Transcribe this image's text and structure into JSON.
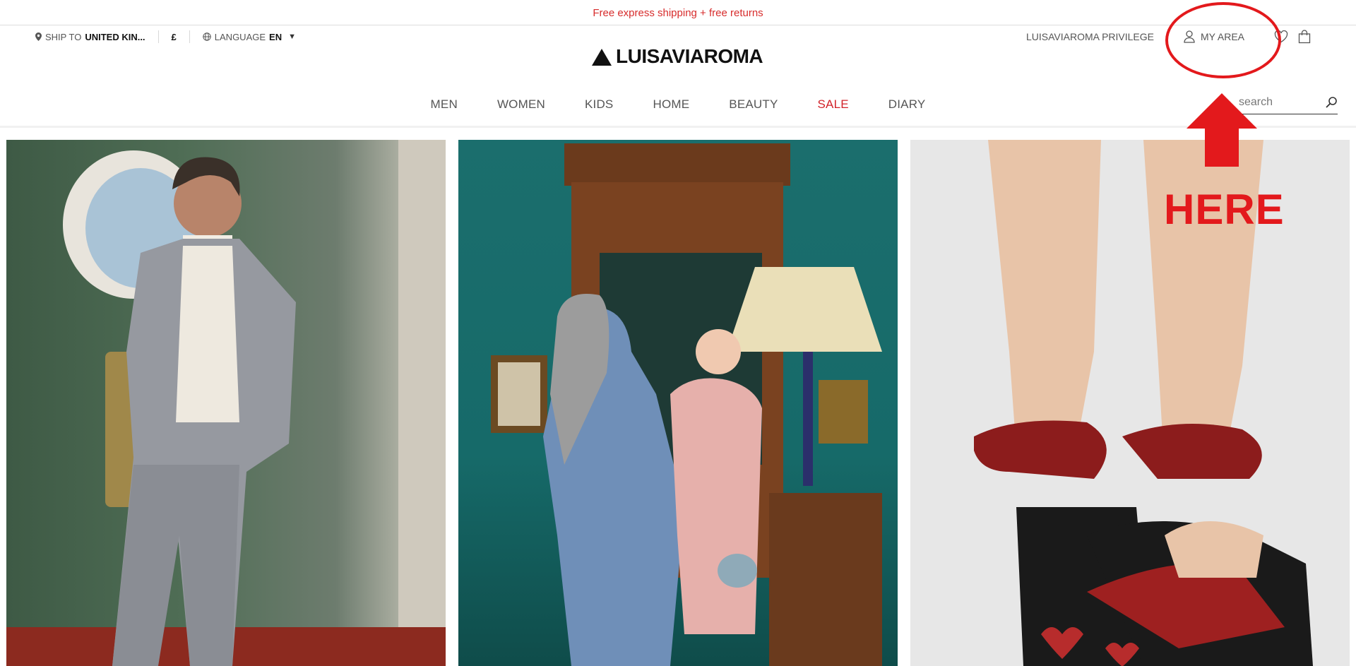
{
  "promo": {
    "text": "Free express shipping + free returns"
  },
  "utility_left": {
    "ship_to_label": "SHIP TO",
    "ship_to_value": "UNITED KIN...",
    "currency": "£",
    "language_label": "LANGUAGE",
    "language_value": "EN"
  },
  "logo": {
    "text": "LUISAVIAROMA"
  },
  "utility_right": {
    "privilege": "LUISAVIAROMA PRIVILEGE",
    "my_area": "MY AREA"
  },
  "nav": {
    "items": [
      {
        "label": "MEN"
      },
      {
        "label": "WOMEN"
      },
      {
        "label": "KIDS"
      },
      {
        "label": "HOME"
      },
      {
        "label": "BEAUTY"
      },
      {
        "label": "SALE"
      },
      {
        "label": "DIARY"
      }
    ]
  },
  "search": {
    "placeholder": "search"
  },
  "annotation": {
    "text": "HERE",
    "color": "#e3191c"
  },
  "icons": [
    "location-pin-icon",
    "globe-icon",
    "caret-down-icon",
    "user-icon",
    "heart-icon",
    "bag-icon",
    "search-icon",
    "arrow-up-icon"
  ],
  "colors": {
    "promo": "#d72c2c",
    "sale": "#d2232a"
  }
}
